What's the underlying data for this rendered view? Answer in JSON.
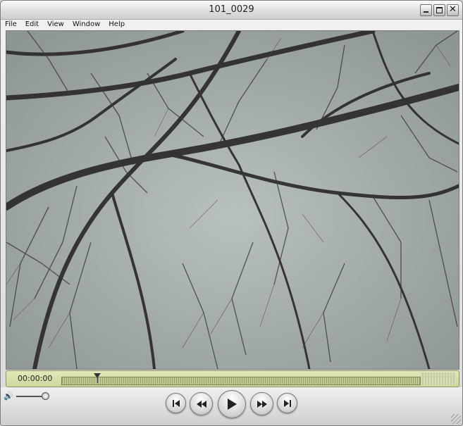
{
  "window": {
    "title": "101_0029"
  },
  "menu": {
    "items": [
      "File",
      "Edit",
      "View",
      "Window",
      "Help"
    ]
  },
  "player": {
    "current_time": "00:00:00",
    "progress_fraction": 0.1,
    "volume_fraction": 0.9
  },
  "controls": {
    "prev_icon": "skip-to-start-icon",
    "rewind_icon": "rewind-icon",
    "play_icon": "play-icon",
    "fast_forward_icon": "fast-forward-icon",
    "next_icon": "skip-to-end-icon"
  }
}
